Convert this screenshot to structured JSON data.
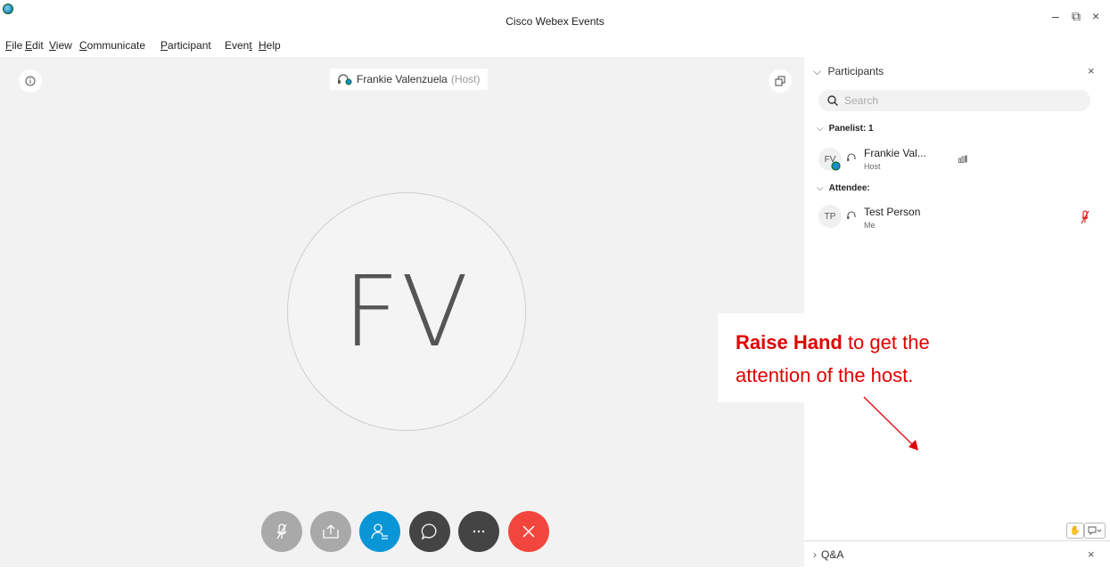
{
  "window": {
    "title": "Cisco Webex Events",
    "controls": {
      "minimize": "–",
      "restore": "⧉",
      "close": "×"
    }
  },
  "menu": {
    "items": [
      {
        "u": "F",
        "rest": "ile"
      },
      {
        "u": "E",
        "rest": "dit"
      },
      {
        "u": "V",
        "rest": "iew"
      },
      {
        "u": "C",
        "rest": "ommunicate"
      },
      {
        "u": "P",
        "rest": "articipant"
      },
      {
        "pre": "Even",
        "u": "t"
      },
      {
        "u": "H",
        "rest": "elp"
      }
    ]
  },
  "stage": {
    "host_name": "Frankie Valenzuela",
    "host_role": "(Host)",
    "avatar_initials": "FV"
  },
  "callout": {
    "bold": "Raise Hand",
    "line1_rest": " to get the",
    "line2": "attention of the host."
  },
  "panel": {
    "title": "Participants",
    "search_placeholder": "Search",
    "panelist_section": "Panelist: 1",
    "attendee_section": "Attendee:",
    "participants": [
      {
        "initials": "FV",
        "name": "Frankie Val...",
        "role": "Host"
      },
      {
        "initials": "TP",
        "name": "Test Person",
        "role": "Me"
      }
    ],
    "qa_label": "Q&A"
  },
  "colors": {
    "accent": "#0a96d6",
    "leave": "#f2453d",
    "annotation": "#e00000"
  },
  "icons": [
    "app-logo-icon",
    "info-icon",
    "headset-icon",
    "layout-icon",
    "mic-muted-icon",
    "share-icon",
    "participants-icon",
    "chat-icon",
    "more-icon",
    "leave-icon",
    "search-icon",
    "chevron-down-icon",
    "chevron-right-icon",
    "close-icon",
    "audio-level-icon",
    "raise-hand-icon",
    "caption-icon"
  ]
}
